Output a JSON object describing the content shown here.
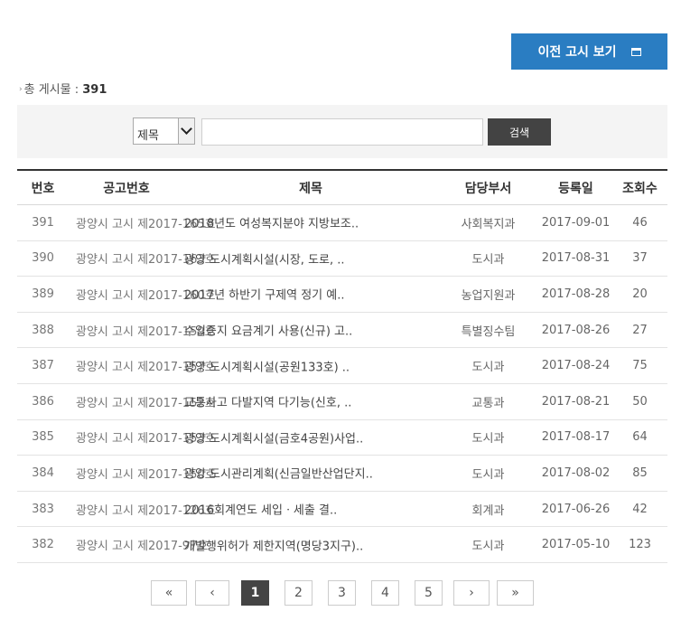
{
  "header": {
    "prev_notice_button": "이전 고시 보기"
  },
  "summary": {
    "label": "총 게시물 :",
    "count": "391"
  },
  "search": {
    "select_value": "제목",
    "input_value": "",
    "button_label": "검색"
  },
  "table": {
    "columns": [
      "번호",
      "공고번호",
      "제목",
      "담당부서",
      "등록일",
      "조회수"
    ],
    "rows": [
      {
        "no": "391",
        "notice": "광양시 고시 제2017-165호",
        "title": "2018년도 여성복지분야 지방보조..",
        "dept": "사회복지과",
        "date": "2017-09-01",
        "views": "46"
      },
      {
        "no": "390",
        "notice": "광양시 고시 제2017-163호",
        "title": "광양 도시계획시설(시장, 도로, ..",
        "dept": "도시과",
        "date": "2017-08-31",
        "views": "37"
      },
      {
        "no": "389",
        "notice": "광양시 고시 제2017-160호",
        "title": "2017년 하반기 구제역 정기 예..",
        "dept": "농업지원과",
        "date": "2017-08-28",
        "views": "20"
      },
      {
        "no": "388",
        "notice": "광양시 고시 제2017-159호",
        "title": "수입증지 요금계기 사용(신규) 고..",
        "dept": "특별징수팀",
        "date": "2017-08-26",
        "views": "27"
      },
      {
        "no": "387",
        "notice": "광양시 고시 제2017-157호",
        "title": "광양 도시계획시설(공원133호) ..",
        "dept": "도시과",
        "date": "2017-08-24",
        "views": "75"
      },
      {
        "no": "386",
        "notice": "광양시 고시 제2017-152호",
        "title": "교통사고 다발지역 다기능(신호, ..",
        "dept": "교통과",
        "date": "2017-08-21",
        "views": "50"
      },
      {
        "no": "385",
        "notice": "광양시 고시 제2017-153호",
        "title": "광양 도시계획시설(금호4공원)사업..",
        "dept": "도시과",
        "date": "2017-08-17",
        "views": "64"
      },
      {
        "no": "384",
        "notice": "광양시 고시 제2017-150호",
        "title": "광양 도시관리계획(신금일반산업단지..",
        "dept": "도시과",
        "date": "2017-08-02",
        "views": "85"
      },
      {
        "no": "383",
        "notice": "광양시 고시 제2017-126호",
        "title": "2016회계연도 세입ㆍ세출 결..",
        "dept": "회계과",
        "date": "2017-06-26",
        "views": "42"
      },
      {
        "no": "382",
        "notice": "광양시 고시 제2017-97호",
        "title": "개발행위허가 제한지역(명당3지구)..",
        "dept": "도시과",
        "date": "2017-05-10",
        "views": "123"
      }
    ]
  },
  "pagination": {
    "first": "«",
    "prev": "‹",
    "pages": [
      "1",
      "2",
      "3",
      "4",
      "5"
    ],
    "current": "1",
    "next": "›",
    "last": "»"
  }
}
